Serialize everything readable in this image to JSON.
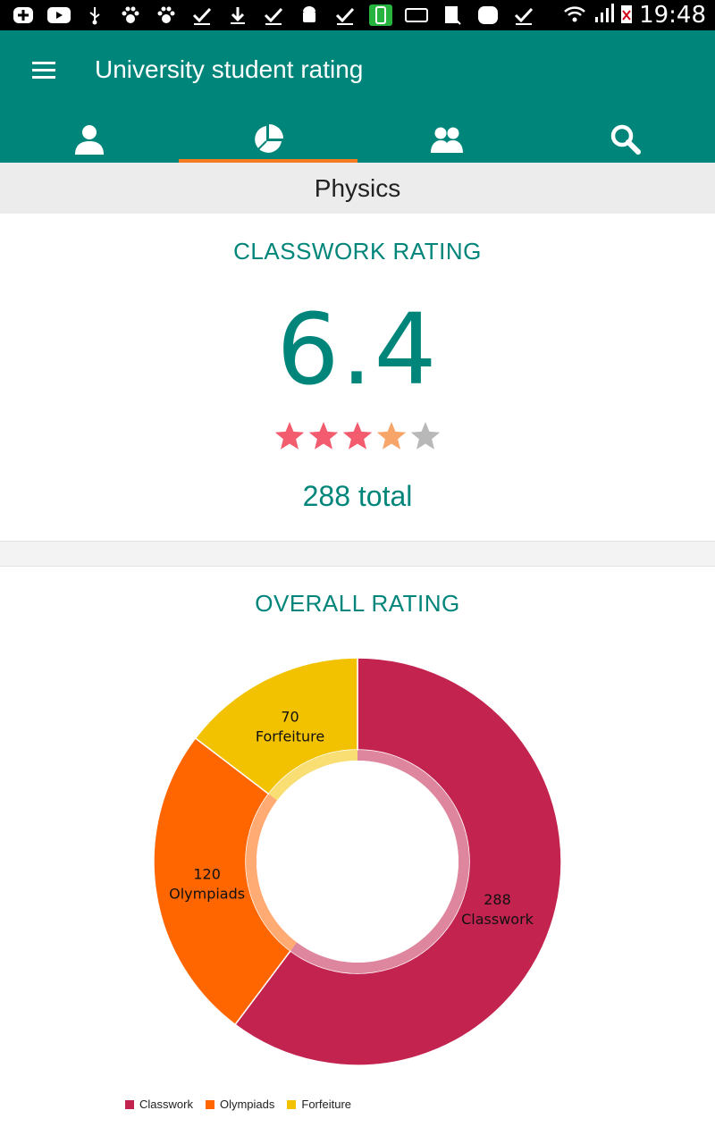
{
  "status_bar": {
    "time": "19:48"
  },
  "app_bar": {
    "title": "University student rating",
    "tabs": [
      {
        "icon": "person-icon",
        "active": false
      },
      {
        "icon": "pie-chart-icon",
        "active": true
      },
      {
        "icon": "group-icon",
        "active": false
      },
      {
        "icon": "search-icon",
        "active": false
      }
    ]
  },
  "subject": "Physics",
  "classwork": {
    "heading": "CLASSWORK RATING",
    "rating": "6.4",
    "stars": 3.4,
    "total_text": "288 total"
  },
  "overall": {
    "heading": "OVERALL RATING"
  },
  "chart_data": {
    "type": "pie",
    "donut": true,
    "categories": [
      "Classwork",
      "Olympiads",
      "Forfeiture"
    ],
    "values": [
      288,
      120,
      70
    ],
    "colors": [
      "#c2234f",
      "#ff6600",
      "#f2c200"
    ],
    "legend": "bottom-left",
    "data_labels": [
      {
        "value": "288",
        "name": "Classwork"
      },
      {
        "value": "120",
        "name": "Olympiads"
      },
      {
        "value": "70",
        "name": "Forfeiture"
      }
    ]
  },
  "colors": {
    "primary": "#00857a",
    "accent": "#f57c1f",
    "star_full": "#f35c6e",
    "star_partial": "#f8a56a",
    "star_empty": "#b8b8b8"
  }
}
